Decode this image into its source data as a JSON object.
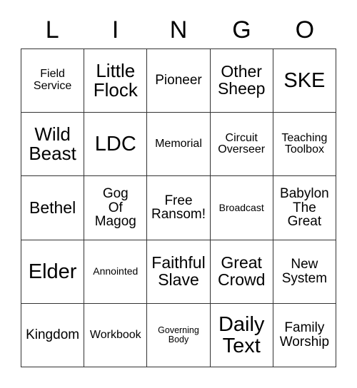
{
  "card": {
    "title_letters": [
      "L",
      "I",
      "N",
      "G",
      "O"
    ],
    "columns": 5,
    "rows": 5,
    "grid_border_color": "#333333",
    "background_color": "#ffffff",
    "text_color": "#000000",
    "cells": [
      {
        "text": "Field\nService",
        "size": "s"
      },
      {
        "text": "Little\nFlock",
        "size": "xl"
      },
      {
        "text": "Pioneer",
        "size": "m"
      },
      {
        "text": "Other\nSheep",
        "size": "l"
      },
      {
        "text": "SKE",
        "size": "xxl"
      },
      {
        "text": "Wild\nBeast",
        "size": "xl"
      },
      {
        "text": "LDC",
        "size": "xxl"
      },
      {
        "text": "Memorial",
        "size": "s"
      },
      {
        "text": "Circuit\nOverseer",
        "size": "s"
      },
      {
        "text": "Teaching\nToolbox",
        "size": "s"
      },
      {
        "text": "Bethel",
        "size": "l"
      },
      {
        "text": "Gog\nOf\nMagog",
        "size": "m"
      },
      {
        "text": "Free\nRansom!",
        "size": "m"
      },
      {
        "text": "Broadcast",
        "size": "xs"
      },
      {
        "text": "Babylon\nThe\nGreat",
        "size": "m"
      },
      {
        "text": "Elder",
        "size": "xxl"
      },
      {
        "text": "Annointed",
        "size": "xs"
      },
      {
        "text": "Faithful\nSlave",
        "size": "l"
      },
      {
        "text": "Great\nCrowd",
        "size": "l"
      },
      {
        "text": "New\nSystem",
        "size": "m"
      },
      {
        "text": "Kingdom",
        "size": "m"
      },
      {
        "text": "Workbook",
        "size": "s"
      },
      {
        "text": "Governing\nBody",
        "size": "xxs"
      },
      {
        "text": "Daily\nText",
        "size": "xxl"
      },
      {
        "text": "Family\nWorship",
        "size": "m"
      }
    ]
  }
}
